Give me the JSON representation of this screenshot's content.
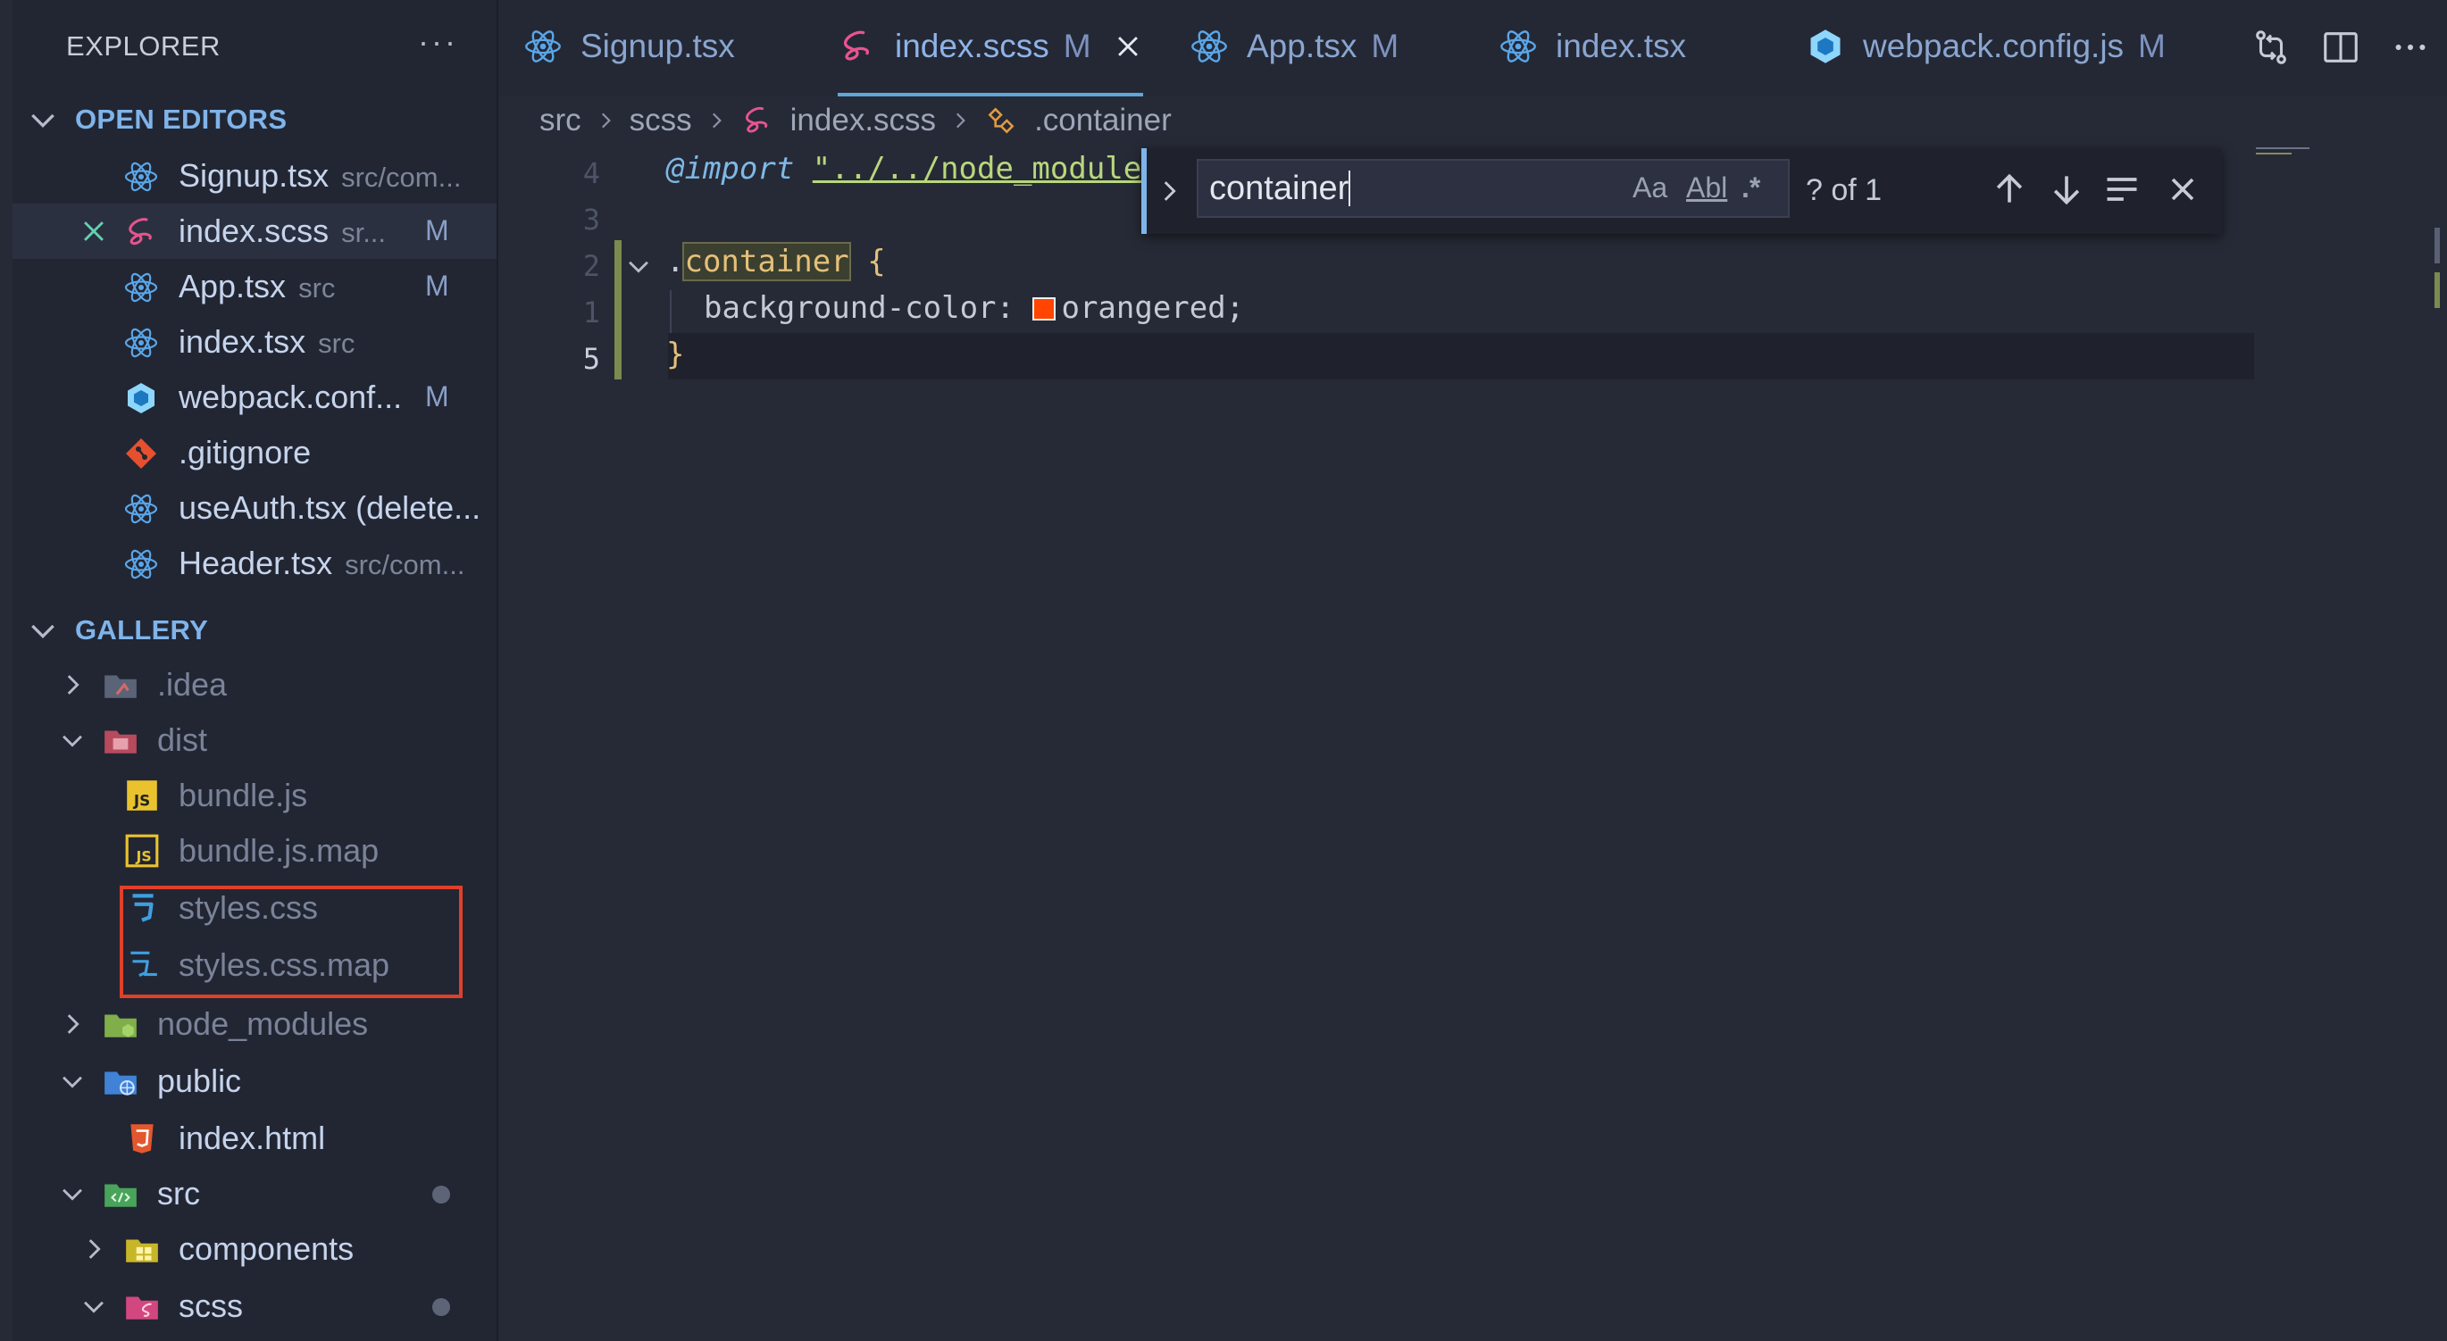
{
  "sidebar": {
    "title": "EXPLORER",
    "more": "···",
    "open_editors": {
      "header": "OPEN EDITORS",
      "items": [
        {
          "name": "Signup.tsx",
          "path": "src/com...",
          "icon": "react-icon",
          "modified": ""
        },
        {
          "name": "index.scss",
          "path": "sr...",
          "icon": "sass-icon",
          "modified": "M",
          "active": true
        },
        {
          "name": "App.tsx",
          "path": "src",
          "icon": "react-icon",
          "modified": "M"
        },
        {
          "name": "index.tsx",
          "path": "src",
          "icon": "react-icon",
          "modified": ""
        },
        {
          "name": "webpack.conf...",
          "path": "",
          "icon": "webpack-icon",
          "modified": "M"
        },
        {
          "name": ".gitignore",
          "path": "",
          "icon": "git-icon",
          "modified": ""
        },
        {
          "name": "useAuth.tsx (delete...",
          "path": "",
          "icon": "react-icon",
          "modified": ""
        },
        {
          "name": "Header.tsx",
          "path": "src/com...",
          "icon": "react-icon",
          "modified": ""
        }
      ]
    },
    "gallery": {
      "header": "GALLERY",
      "items": [
        {
          "name": ".idea",
          "type": "folder",
          "expanded": false,
          "color": "#7b8399"
        },
        {
          "name": "dist",
          "type": "folder",
          "expanded": true,
          "color": "#7b8399"
        },
        {
          "name": "bundle.js",
          "type": "file",
          "color": "#7b8399"
        },
        {
          "name": "bundle.js.map",
          "type": "file",
          "color": "#7b8399"
        },
        {
          "name": "styles.css",
          "type": "file",
          "color": "#7b8399"
        },
        {
          "name": "styles.css.map",
          "type": "file",
          "color": "#7b8399"
        },
        {
          "name": "node_modules",
          "type": "folder",
          "expanded": false,
          "color": "#7b8399"
        },
        {
          "name": "public",
          "type": "folder",
          "expanded": true,
          "color": "#c6d4ec"
        },
        {
          "name": "index.html",
          "type": "file",
          "color": "#c6d4ec"
        },
        {
          "name": "src",
          "type": "folder",
          "expanded": true,
          "color": "#c6d4ec"
        },
        {
          "name": "components",
          "type": "folder",
          "expanded": false,
          "color": "#c6d4ec"
        },
        {
          "name": "scss",
          "type": "folder",
          "expanded": true,
          "color": "#c6d4ec"
        }
      ]
    }
  },
  "tabs": [
    {
      "label": "Signup.tsx",
      "modified": "",
      "icon": "react-icon"
    },
    {
      "label": "index.scss",
      "modified": "M",
      "icon": "sass-icon",
      "active": true
    },
    {
      "label": "App.tsx",
      "modified": "M",
      "icon": "react-icon"
    },
    {
      "label": "index.tsx",
      "modified": "",
      "icon": "react-icon"
    },
    {
      "label": "webpack.config.js",
      "modified": "M",
      "icon": "webpack-icon"
    }
  ],
  "breadcrumb": [
    "src",
    "scss",
    "index.scss",
    ".container"
  ],
  "editor": {
    "line_numbers": [
      "4",
      "3",
      "2",
      "1",
      "5"
    ],
    "import_kw": "@import",
    "import_str": "\"../../node_module",
    "selector_dot": ".",
    "selector": "container",
    "brace_open": "{",
    "property": "background-color:",
    "value": "orangered;",
    "brace_close": "}",
    "swatch_color": "#ff4500"
  },
  "find": {
    "query": "container",
    "match_case": "Aa",
    "whole_word": "Abl",
    "regex": ".*",
    "count": "? of 1"
  },
  "colors": {
    "accent": "#7fb4ea",
    "highlight_box": "#e0402a"
  }
}
